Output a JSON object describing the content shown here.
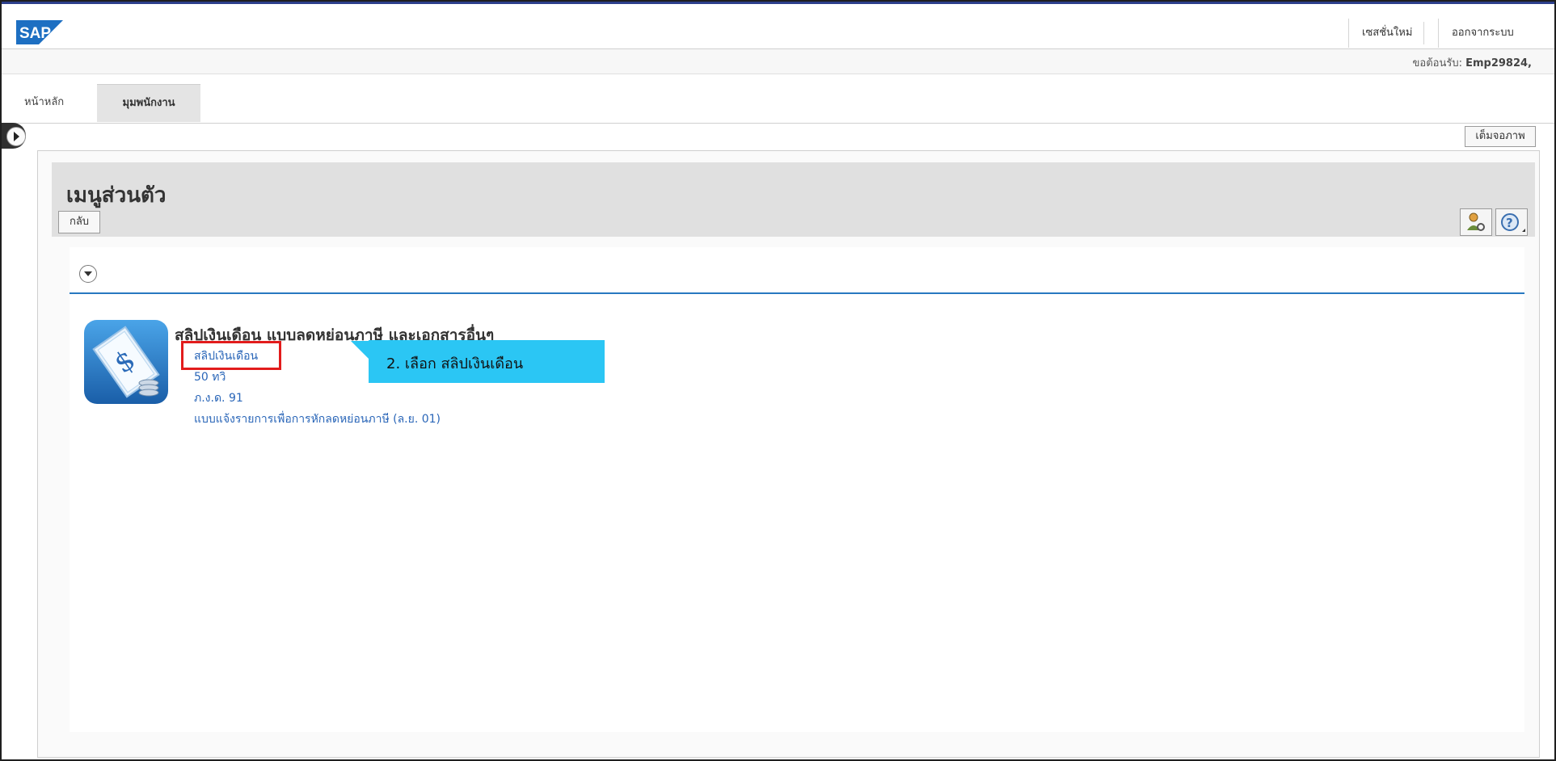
{
  "header": {
    "logo_text": "SAP",
    "new_session": "เซสชั่นใหม่",
    "logout": "ออกจากระบบ",
    "welcome_label": "ขอต้อนรับ:",
    "welcome_user": "Emp29824,"
  },
  "tabs": [
    {
      "label": "หน้าหลัก"
    },
    {
      "label": "มุมพนักงาน"
    }
  ],
  "toolbar": {
    "fullscreen": "เต็มจอภาพ"
  },
  "menu": {
    "title": "เมนูส่วนตัว",
    "back": "กลับ"
  },
  "group": {
    "title": "สลิปเงินเดือน แบบลดหย่อนภาษี และเอกสารอื่นๆ",
    "links": [
      "สลิปเงินเดือน",
      "50 ทวิ",
      "ภ.ง.ด. 91",
      "แบบแจ้งรายการเพื่อการหักลดหย่อนภาษี (ล.ย. 01)"
    ]
  },
  "callout": {
    "text": "2. เลือก สลิปเงินเดือน"
  },
  "colors": {
    "accent_blue": "#2878c0",
    "callout": "#2bc6f4",
    "highlight": "#e21c1c"
  }
}
